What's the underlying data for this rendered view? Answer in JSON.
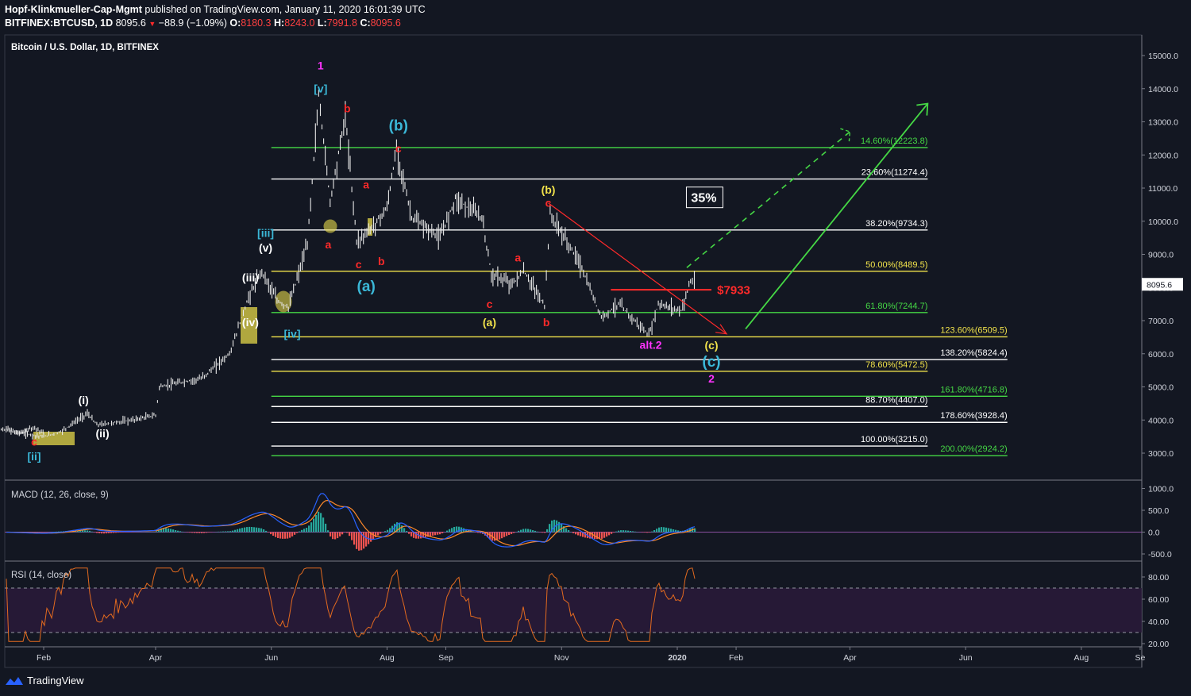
{
  "header": {
    "publisher": "Hopf-Klinkmueller-Cap-Mgmt",
    "published_text": "published on TradingView.com, January 11, 2020 16:01:39 UTC",
    "symbol": "BITFINEX:BTCUSD, 1D",
    "last": "8095.6",
    "change": "−88.9 (−1.09%)",
    "o_label": "O:",
    "o": "8180.3",
    "h_label": "H:",
    "h": "8243.0",
    "l_label": "L:",
    "l": "7991.8",
    "c_label": "C:",
    "c": "8095.6"
  },
  "footer": {
    "brand": "TradingView"
  },
  "colors": {
    "bg": "#131722",
    "up": "#ffffff",
    "red": "#ff2a2a",
    "green": "#45d845",
    "yellow": "#f2e34b",
    "cyan": "#3bb8d8",
    "magenta": "#ff33ff",
    "macd": "#2962ff",
    "signal": "#ff8a2a",
    "rsi": "#e36a1f"
  },
  "chart_data": {
    "type": "line",
    "title": "Bitcoin / U.S. Dollar, 1D, BITFINEX",
    "price_scale": {
      "ticks": [
        "15000.0",
        "14000.0",
        "13000.0",
        "12000.0",
        "11000.0",
        "10000.0",
        "9000.0",
        "8000.0",
        "7000.0",
        "6000.0",
        "5000.0",
        "4000.0",
        "3000.0"
      ],
      "values": [
        15000,
        14000,
        13000,
        12000,
        11000,
        10000,
        9000,
        8000,
        7000,
        6000,
        5000,
        4000,
        3000
      ],
      "last_price": "8095.6"
    },
    "x_axis": {
      "ticks": [
        "Feb",
        "Apr",
        "Jun",
        "Aug",
        "Sep",
        "Nov",
        "2020",
        "Feb",
        "Apr",
        "Jun",
        "Aug",
        "Se"
      ],
      "dates": [
        "2019-02-01",
        "2019-04-01",
        "2019-06-01",
        "2019-08-01",
        "2019-09-01",
        "2019-11-01",
        "2020-01-01",
        "2020-02-01",
        "2020-04-01",
        "2020-06-01",
        "2020-08-01",
        "2020-09-01"
      ]
    },
    "price_series": [
      {
        "date": "2019-01-01",
        "price": 3800
      },
      {
        "date": "2019-01-20",
        "price": 3600
      },
      {
        "date": "2019-02-01",
        "price": 3500
      },
      {
        "date": "2019-02-10",
        "price": 3650
      },
      {
        "date": "2019-02-24",
        "price": 4200
      },
      {
        "date": "2019-03-01",
        "price": 3850
      },
      {
        "date": "2019-03-20",
        "price": 4000
      },
      {
        "date": "2019-04-01",
        "price": 4150
      },
      {
        "date": "2019-04-03",
        "price": 5000
      },
      {
        "date": "2019-04-25",
        "price": 5250
      },
      {
        "date": "2019-05-10",
        "price": 6000
      },
      {
        "date": "2019-05-20",
        "price": 7700
      },
      {
        "date": "2019-05-27",
        "price": 8500
      },
      {
        "date": "2019-06-04",
        "price": 7600
      },
      {
        "date": "2019-06-10",
        "price": 7400
      },
      {
        "date": "2019-06-20",
        "price": 9300
      },
      {
        "date": "2019-06-26",
        "price": 13800
      },
      {
        "date": "2019-07-02",
        "price": 10600
      },
      {
        "date": "2019-07-10",
        "price": 13200
      },
      {
        "date": "2019-07-16",
        "price": 9400
      },
      {
        "date": "2019-07-24",
        "price": 9800
      },
      {
        "date": "2019-08-01",
        "price": 10400
      },
      {
        "date": "2019-08-06",
        "price": 12200
      },
      {
        "date": "2019-08-14",
        "price": 10100
      },
      {
        "date": "2019-08-29",
        "price": 9500
      },
      {
        "date": "2019-09-06",
        "price": 10700
      },
      {
        "date": "2019-09-20",
        "price": 10100
      },
      {
        "date": "2019-09-25",
        "price": 8400
      },
      {
        "date": "2019-10-06",
        "price": 8100
      },
      {
        "date": "2019-10-12",
        "price": 8500
      },
      {
        "date": "2019-10-23",
        "price": 7450
      },
      {
        "date": "2019-10-26",
        "price": 10200
      },
      {
        "date": "2019-11-10",
        "price": 8800
      },
      {
        "date": "2019-11-22",
        "price": 7100
      },
      {
        "date": "2019-12-01",
        "price": 7500
      },
      {
        "date": "2019-12-17",
        "price": 6550
      },
      {
        "date": "2019-12-22",
        "price": 7500
      },
      {
        "date": "2020-01-03",
        "price": 7300
      },
      {
        "date": "2020-01-08",
        "price": 8200
      },
      {
        "date": "2020-01-11",
        "price": 8095.6
      }
    ],
    "fib_levels": [
      {
        "label": "14.60%(12223.8)",
        "value": 12223.8,
        "color": "#45d845",
        "from": "2019-06-01",
        "to": "2020-05-12"
      },
      {
        "label": "23.60%(11274.4)",
        "value": 11274.4,
        "color": "#ffffff",
        "from": "2019-06-01",
        "to": "2020-05-12"
      },
      {
        "label": "38.20%(9734.3)",
        "value": 9734.3,
        "color": "#ffffff",
        "from": "2019-06-01",
        "to": "2020-05-12"
      },
      {
        "label": "50.00%(8489.5)",
        "value": 8489.5,
        "color": "#f2e34b",
        "from": "2019-06-01",
        "to": "2020-05-12"
      },
      {
        "label": "61.80%(7244.7)",
        "value": 7244.7,
        "color": "#45d845",
        "from": "2019-06-01",
        "to": "2020-05-12"
      },
      {
        "label": "123.60%(6509.5)",
        "value": 6509.5,
        "color": "#f2e34b",
        "from": "2019-06-01",
        "to": "2020-06-23"
      },
      {
        "label": "138.20%(5824.4)",
        "value": 5824.4,
        "color": "#ffffff",
        "from": "2019-06-01",
        "to": "2020-06-23"
      },
      {
        "label": "78.60%(5472.5)",
        "value": 5472.5,
        "color": "#f2e34b",
        "from": "2019-06-01",
        "to": "2020-05-12"
      },
      {
        "label": "161.80%(4716.8)",
        "value": 4716.8,
        "color": "#45d845",
        "from": "2019-06-01",
        "to": "2020-06-23"
      },
      {
        "label": "88.70%(4407.0)",
        "value": 4407.0,
        "color": "#ffffff",
        "from": "2019-06-01",
        "to": "2020-05-12"
      },
      {
        "label": "178.60%(3928.4)",
        "value": 3928.4,
        "color": "#ffffff",
        "from": "2019-06-01",
        "to": "2020-06-23"
      },
      {
        "label": "100.00%(3215.0)",
        "value": 3215.0,
        "color": "#ffffff",
        "from": "2019-06-01",
        "to": "2020-05-12"
      },
      {
        "label": "200.00%(2924.2)",
        "value": 2924.2,
        "color": "#45d845",
        "from": "2019-06-01",
        "to": "2020-06-23"
      }
    ],
    "annotations": [
      {
        "text": "1",
        "date": "2019-06-27",
        "price": 14700,
        "color": "#ff33ff"
      },
      {
        "text": "[v]",
        "date": "2019-06-27",
        "price": 14000,
        "color": "#3bb8d8"
      },
      {
        "text": "b",
        "date": "2019-07-11",
        "price": 13400,
        "color": "#ff2a2a"
      },
      {
        "text": "(b)",
        "date": "2019-08-07",
        "price": 12900,
        "color": "#3bb8d8"
      },
      {
        "text": "c",
        "date": "2019-08-07",
        "price": 12200,
        "color": "#ff2a2a"
      },
      {
        "text": "a",
        "date": "2019-07-21",
        "price": 11100,
        "color": "#ff2a2a"
      },
      {
        "text": "a",
        "date": "2019-07-01",
        "price": 9300,
        "color": "#ff2a2a"
      },
      {
        "text": "c",
        "date": "2019-07-17",
        "price": 8700,
        "color": "#ff2a2a"
      },
      {
        "text": "b",
        "date": "2019-07-29",
        "price": 8800,
        "color": "#ff2a2a"
      },
      {
        "text": "(a)",
        "date": "2019-07-21",
        "price": 8050,
        "color": "#3bb8d8"
      },
      {
        "text": "[iii]",
        "date": "2019-05-29",
        "price": 9650,
        "color": "#3bb8d8"
      },
      {
        "text": "(v)",
        "date": "2019-05-29",
        "price": 9200,
        "color": "#ffffff"
      },
      {
        "text": "(iii)",
        "date": "2019-05-21",
        "price": 8300,
        "color": "#ffffff"
      },
      {
        "text": "(iv)",
        "date": "2019-05-21",
        "price": 6950,
        "color": "#ffffff"
      },
      {
        "text": "[iv]",
        "date": "2019-06-12",
        "price": 6600,
        "color": "#3bb8d8"
      },
      {
        "text": "(i)",
        "date": "2019-02-22",
        "price": 4600,
        "color": "#ffffff"
      },
      {
        "text": "(ii)",
        "date": "2019-03-04",
        "price": 3600,
        "color": "#ffffff"
      },
      {
        "text": "[ii]",
        "date": "2019-01-27",
        "price": 2900,
        "color": "#3bb8d8"
      },
      {
        "text": "c",
        "date": "2019-01-27",
        "price": 3350,
        "color": "#ff2a2a"
      },
      {
        "text": "c",
        "date": "2019-09-24",
        "price": 7500,
        "color": "#ff2a2a"
      },
      {
        "text": "(a)",
        "date": "2019-09-24",
        "price": 6950,
        "color": "#f2e34b"
      },
      {
        "text": "a",
        "date": "2019-10-09",
        "price": 8900,
        "color": "#ff2a2a"
      },
      {
        "text": "b",
        "date": "2019-10-24",
        "price": 6950,
        "color": "#ff2a2a"
      },
      {
        "text": "(b)",
        "date": "2019-10-25",
        "price": 10950,
        "color": "#f2e34b"
      },
      {
        "text": "c",
        "date": "2019-10-25",
        "price": 10550,
        "color": "#ff2a2a"
      },
      {
        "text": "alt.2",
        "date": "2019-12-18",
        "price": 6270,
        "color": "#ff33ff"
      },
      {
        "text": "(c)",
        "date": "2020-01-19",
        "price": 6250,
        "color": "#f2e34b"
      },
      {
        "text": "(c)",
        "date": "2020-01-19",
        "price": 5770,
        "color": "#3bb8d8"
      },
      {
        "text": "2",
        "date": "2020-01-19",
        "price": 5250,
        "color": "#ff33ff"
      },
      {
        "text": "$7933",
        "date": "2020-01-22",
        "price": 7933,
        "color": "#ff2a2a"
      },
      {
        "text": "35%",
        "date": "2020-01-15",
        "price": 10720,
        "color": "#ffffff"
      }
    ],
    "macd": {
      "title": "MACD (12, 26, close, 9)",
      "ticks": [
        "1000.0",
        "500.0",
        "0.0",
        "-500.0"
      ],
      "values": [
        1000,
        500,
        0,
        -500
      ]
    },
    "rsi": {
      "title": "RSI (14, close)",
      "ticks": [
        "80.00",
        "60.00",
        "40.00",
        "20.00"
      ],
      "values": [
        80,
        60,
        40,
        20
      ],
      "upper": 70,
      "lower": 30
    }
  }
}
